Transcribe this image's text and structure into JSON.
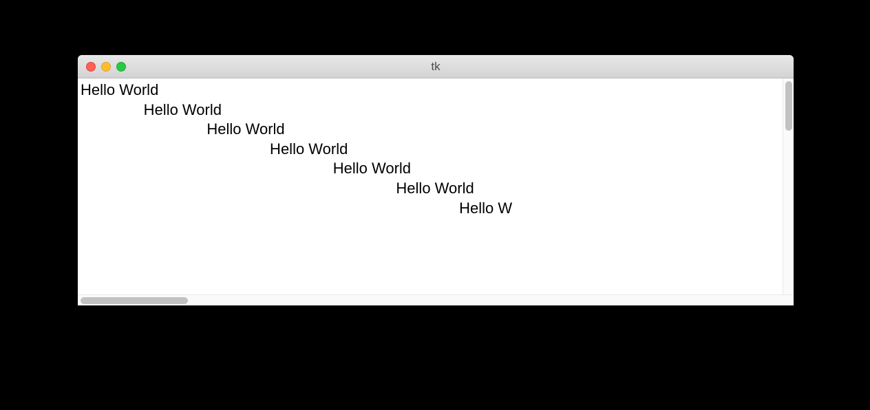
{
  "window": {
    "title": "tk"
  },
  "text": {
    "lines": [
      {
        "indent": 0,
        "content": "Hello World"
      },
      {
        "indent": 1,
        "content": "Hello World"
      },
      {
        "indent": 2,
        "content": "Hello World"
      },
      {
        "indent": 3,
        "content": "Hello World"
      },
      {
        "indent": 4,
        "content": "Hello World"
      },
      {
        "indent": 5,
        "content": "Hello World"
      },
      {
        "indent": 6,
        "content": "Hello W"
      }
    ],
    "tab_spaces": "               "
  }
}
